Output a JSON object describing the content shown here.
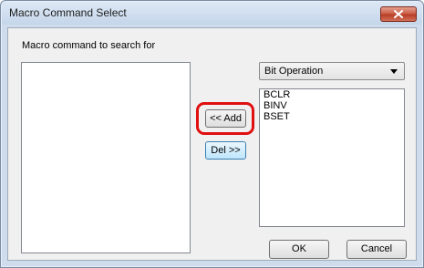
{
  "window": {
    "title": "Macro Command Select"
  },
  "search": {
    "label": "Macro command to search for"
  },
  "category": {
    "selected": "Bit Operation"
  },
  "commands": {
    "items": [
      "BCLR",
      "BINV",
      "BSET"
    ]
  },
  "buttons": {
    "add_label": "<< Add",
    "del_label": "Del >>",
    "ok_label": "OK",
    "cancel_label": "Cancel"
  },
  "colors": {
    "highlight": "#e01010",
    "close_button": "#c75a43"
  }
}
